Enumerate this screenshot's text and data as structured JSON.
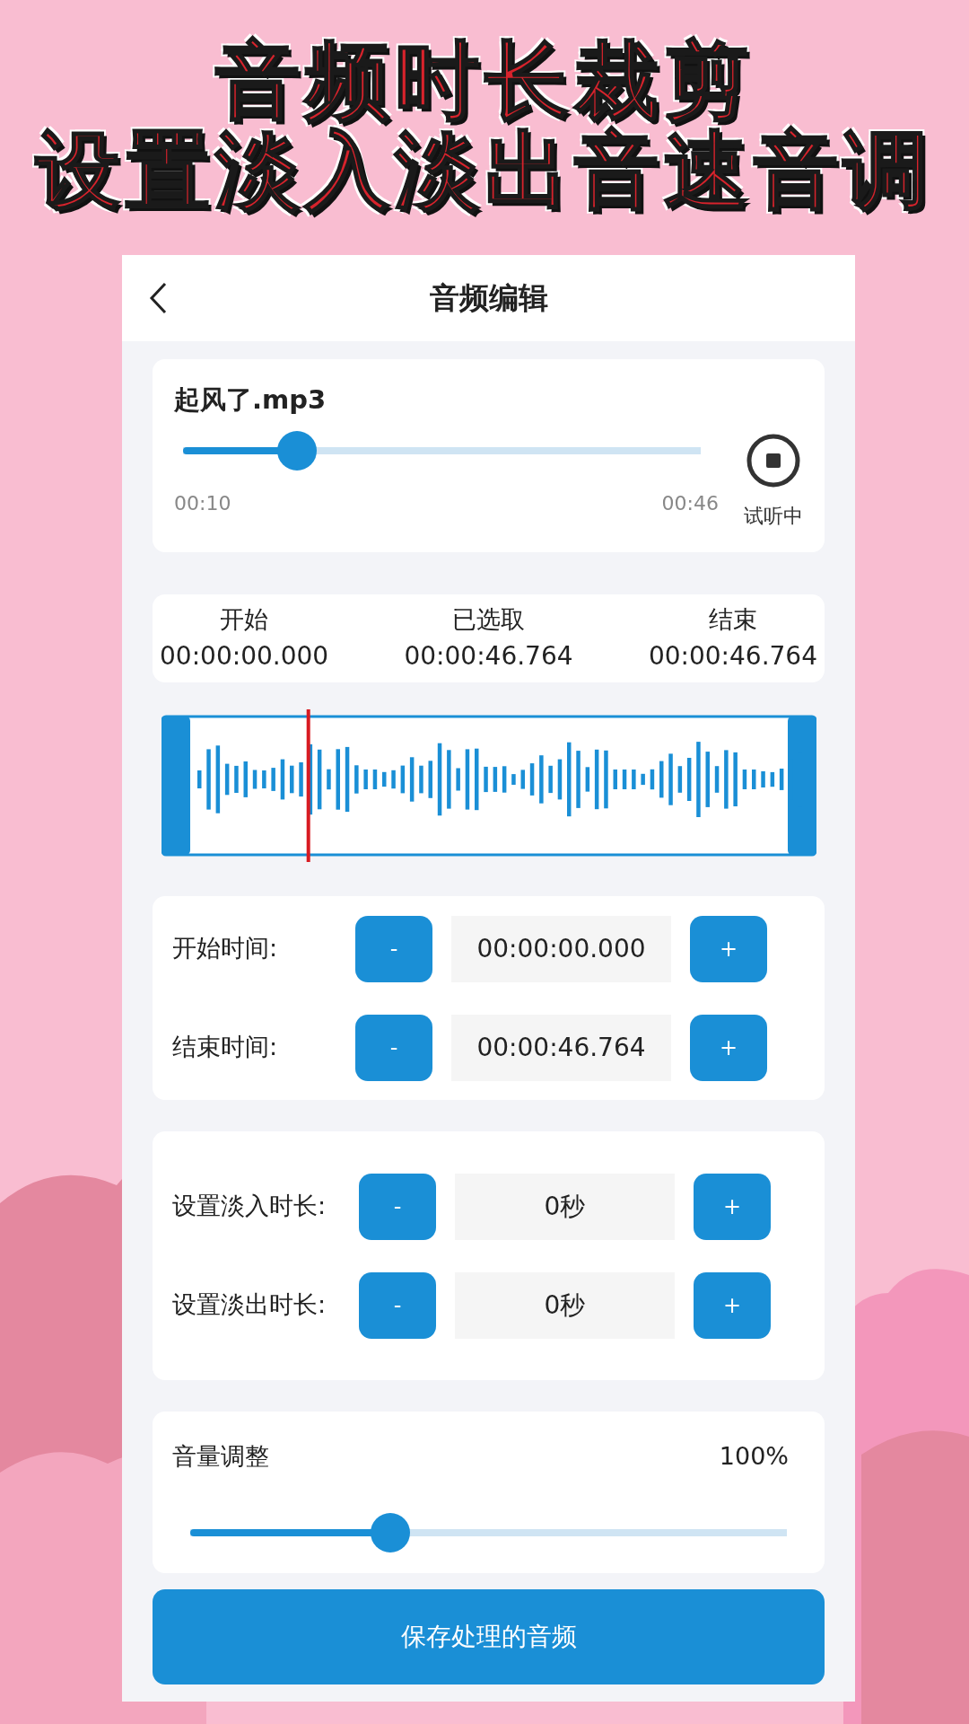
{
  "headline": [
    "音频时长裁剪",
    "设置淡入淡出音速音调"
  ],
  "header": {
    "title": "音频编辑"
  },
  "player": {
    "file": "起风了.mp3",
    "level": 0.22,
    "current": "00:10",
    "total": "00:46",
    "status": "试听中",
    "playing": true
  },
  "selection": [
    {
      "label": "开始",
      "value": "00:00:00.000"
    },
    {
      "label": "已选取",
      "value": "00:00:46.764"
    },
    {
      "label": "结束",
      "value": "00:00:46.764"
    }
  ],
  "waveform": {
    "level": 0.195
  },
  "time_rows": [
    {
      "label": "开始时间:",
      "minus": "-",
      "value": "00:00:00.000",
      "plus": "+"
    },
    {
      "label": "结束时间:",
      "minus": "-",
      "value": "00:00:46.764",
      "plus": "+"
    }
  ],
  "fade_rows": [
    {
      "label": "设置淡入时长:",
      "minus": "-",
      "value": "0秒",
      "plus": "+"
    },
    {
      "label": "设置淡出时长:",
      "minus": "-",
      "value": "0秒",
      "plus": "+"
    }
  ],
  "volume": {
    "label": "音量调整",
    "reading": "100%",
    "level": 0.335
  },
  "save_button": "保存处理的音频"
}
